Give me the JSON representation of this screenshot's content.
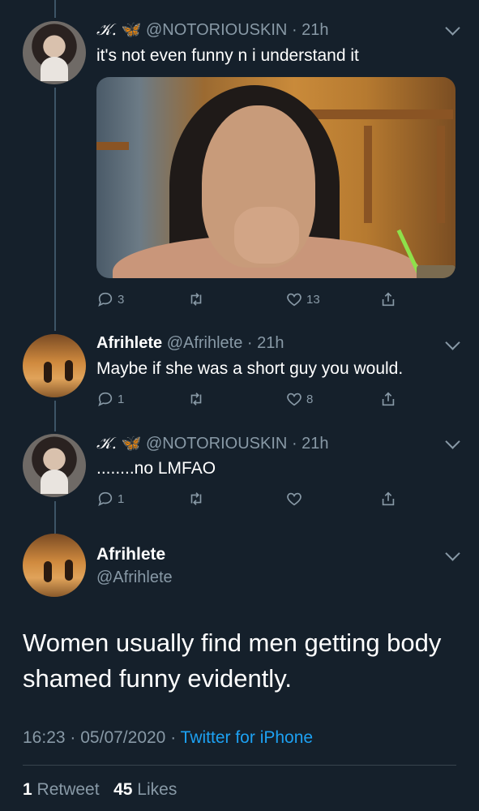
{
  "tweets": [
    {
      "name": "𝒦.",
      "emoji": "🦋",
      "handle": "@NOTORIOUSKIN",
      "time": "21h",
      "text": "it's not even funny n i understand it",
      "replies": "3",
      "retweets": "",
      "likes": "13"
    },
    {
      "name": "Afrihlete",
      "handle": "@Afrihlete",
      "time": "21h",
      "text": "Maybe if she was a short guy you would.",
      "replies": "1",
      "retweets": "",
      "likes": "8"
    },
    {
      "name": "𝒦.",
      "emoji": "🦋",
      "handle": "@NOTORIOUSKIN",
      "time": "21h",
      "text": "........no LMFAO",
      "replies": "1",
      "retweets": "",
      "likes": ""
    }
  ],
  "main_tweet": {
    "name": "Afrihlete",
    "handle": "@Afrihlete",
    "text": "Women usually find men getting body shamed funny evidently.",
    "time": "16:23",
    "date": "05/07/2020",
    "source": "Twitter for iPhone",
    "retweet_count": "1",
    "retweet_label": "Retweet",
    "like_count": "45",
    "like_label": "Likes"
  },
  "colors": {
    "background": "#15202b",
    "muted": "#8899a6",
    "accent": "#1da1f2"
  }
}
